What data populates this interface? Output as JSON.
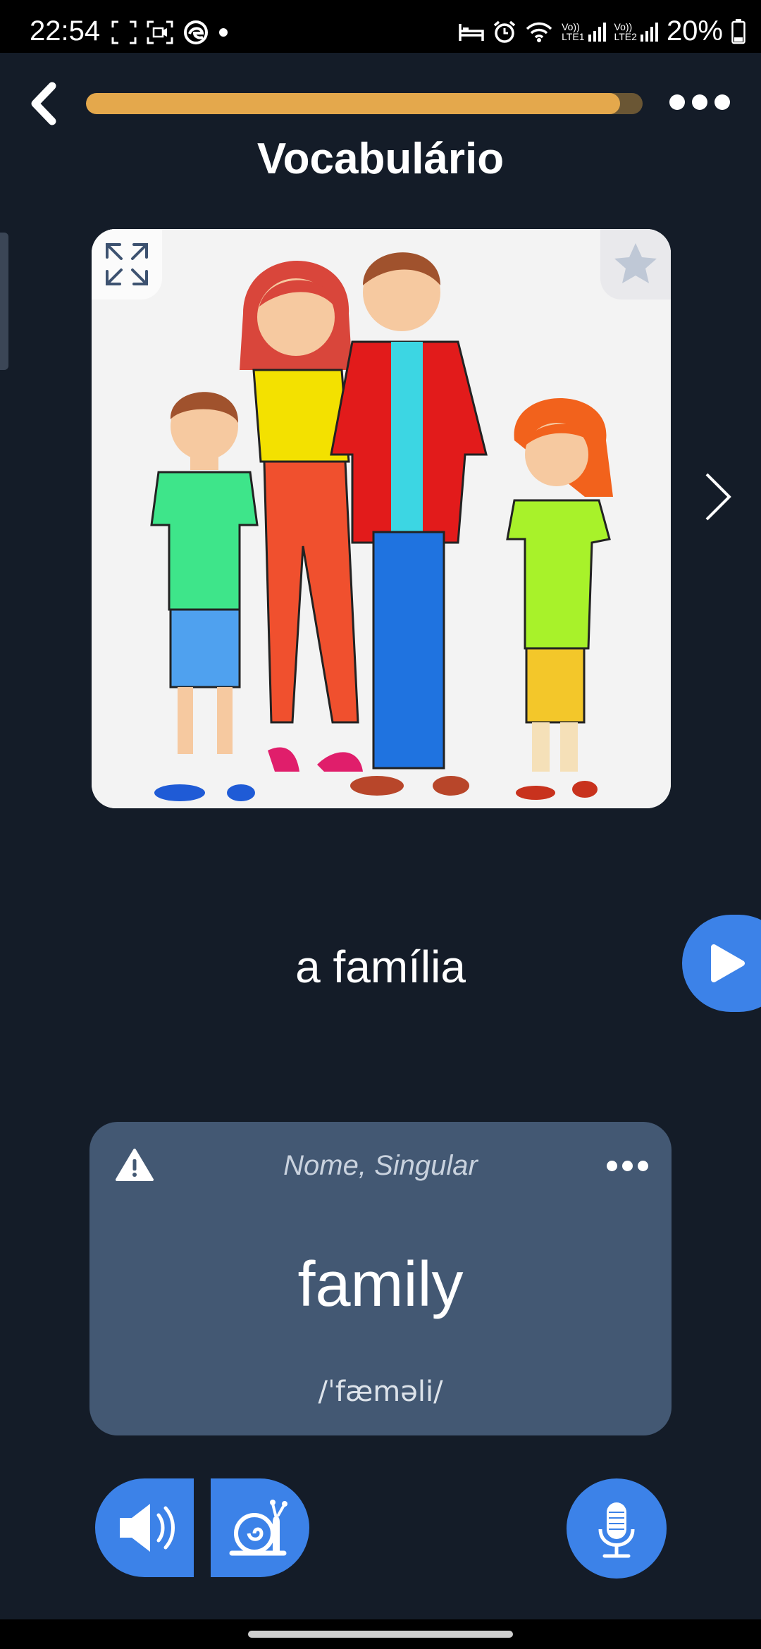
{
  "status_bar": {
    "time": "22:54",
    "battery_percent": "20%",
    "sim1_label": "LTE1",
    "sim2_label": "LTE2",
    "volte_label": "Vo))"
  },
  "header": {
    "title": "Vocabulário",
    "progress": 0.96,
    "progress_color": "#e4a84c",
    "progress_track_color": "#6a5634"
  },
  "flashcard": {
    "image_icon": "family-illustration",
    "word": "a família"
  },
  "translation_card": {
    "part_of_speech": "Nome, Singular",
    "translation": "family",
    "ipa": "/ˈfæməli/"
  },
  "colors": {
    "background": "#141c28",
    "accent": "#3c82e8",
    "card": "#435873"
  },
  "icons": {
    "back": "chevron-left-icon",
    "menu": "more-horizontal-icon",
    "expand": "expand-icon",
    "favorite": "star-icon",
    "next": "chevron-right-icon",
    "play": "play-icon",
    "warning": "warning-icon",
    "audio": "speaker-icon",
    "slow_audio": "snail-icon",
    "microphone": "microphone-icon"
  }
}
